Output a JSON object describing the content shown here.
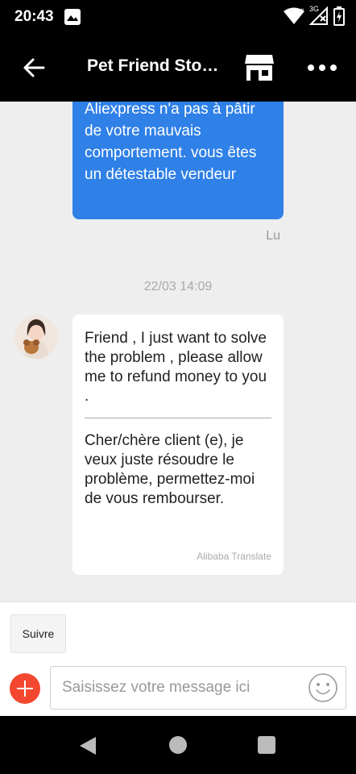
{
  "status_bar": {
    "time": "20:43",
    "network": "3G"
  },
  "header": {
    "title": "Pet Friend Sto…"
  },
  "conversation": {
    "outgoing_message": "Aliexpress n'a pas à pâtir de votre mauvais comportement. vous êtes un détestable vendeur",
    "read_status": "Lu",
    "timestamp": "22/03 14:09",
    "incoming_message": {
      "original": "Friend , I just want to solve the problem , please allow me to refund money to you .",
      "translated": "Cher/chère client (e), je veux juste résoudre le problème, permettez-moi de vous rembourser.",
      "translation_credit": "Alibaba Translate"
    }
  },
  "footer": {
    "follow_label": "Suivre",
    "input_placeholder": "Saisissez votre message ici"
  },
  "colors": {
    "accent_blue": "#2f80e7",
    "add_button_red": "#f3472f",
    "chat_background": "#eeeeee"
  },
  "icons": [
    "back-arrow-icon",
    "store-icon",
    "more-icon",
    "emoji-icon",
    "add-icon",
    "wifi-icon",
    "signal-icon",
    "battery-icon",
    "image-notification-icon"
  ]
}
